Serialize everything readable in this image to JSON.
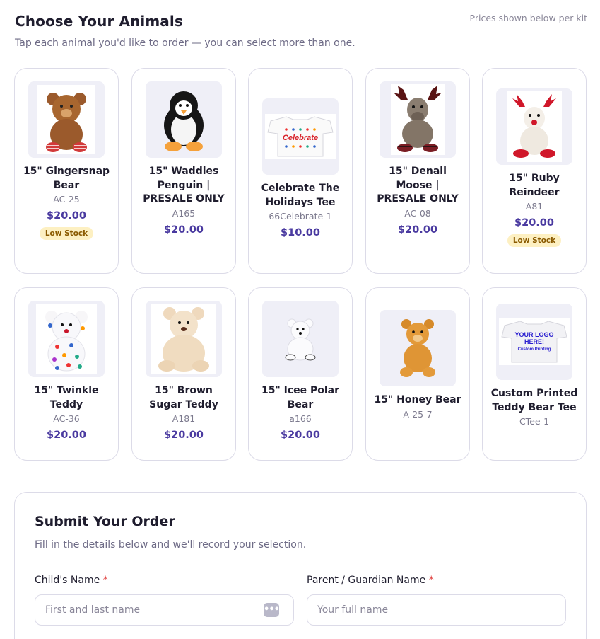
{
  "header": {
    "title": "Choose Your Animals",
    "subtitle": "Tap each animal you'd like to order — you can select more than one.",
    "note": "Prices shown below per kit"
  },
  "products": [
    {
      "name": "15\" Gingersnap Bear",
      "sku": "AC-25",
      "price": "$20.00",
      "badge": "Low Stock",
      "icon": "gingersnap-bear"
    },
    {
      "name": "15\" Waddles Penguin | PRESALE ONLY",
      "sku": "A165",
      "price": "$20.00",
      "badge": "",
      "icon": "penguin"
    },
    {
      "name": "Celebrate The Holidays Tee",
      "sku": "66Celebrate-1",
      "price": "$10.00",
      "badge": "",
      "icon": "celebrate-tee"
    },
    {
      "name": "15\" Denali Moose | PRESALE ONLY",
      "sku": "AC-08",
      "price": "$20.00",
      "badge": "",
      "icon": "moose"
    },
    {
      "name": "15\" Ruby Reindeer",
      "sku": "A81",
      "price": "$20.00",
      "badge": "Low Stock",
      "icon": "reindeer"
    },
    {
      "name": "15\" Twinkle Teddy",
      "sku": "AC-36",
      "price": "$20.00",
      "badge": "",
      "icon": "twinkle-teddy"
    },
    {
      "name": "15\" Brown Sugar Teddy",
      "sku": "A181",
      "price": "$20.00",
      "badge": "",
      "icon": "brown-sugar-teddy"
    },
    {
      "name": "15\" Icee Polar Bear",
      "sku": "a166",
      "price": "$20.00",
      "badge": "",
      "icon": "polar-bear"
    },
    {
      "name": "15\" Honey Bear",
      "sku": "A-25-7",
      "price": "",
      "badge": "",
      "icon": "honey-bear"
    },
    {
      "name": "Custom Printed Teddy Bear Tee",
      "sku": "CTee-1",
      "price": "",
      "badge": "",
      "icon": "custom-tee"
    }
  ],
  "tee_prints": {
    "celebrate": "Celebrate",
    "custom_line1": "YOUR LOGO",
    "custom_line2": "HERE!",
    "custom_line3": "Custom Printing"
  },
  "order": {
    "title": "Submit Your Order",
    "subtitle": "Fill in the details below and we'll record your selection.",
    "child_label": "Child's Name",
    "child_placeholder": "First and last name",
    "parent_label": "Parent / Guardian Name",
    "parent_placeholder": "Your full name",
    "required_mark": "*"
  },
  "colors": {
    "accent_price": "#4a3aa0",
    "badge_bg": "#fdf0c2",
    "required": "#e0413f"
  }
}
